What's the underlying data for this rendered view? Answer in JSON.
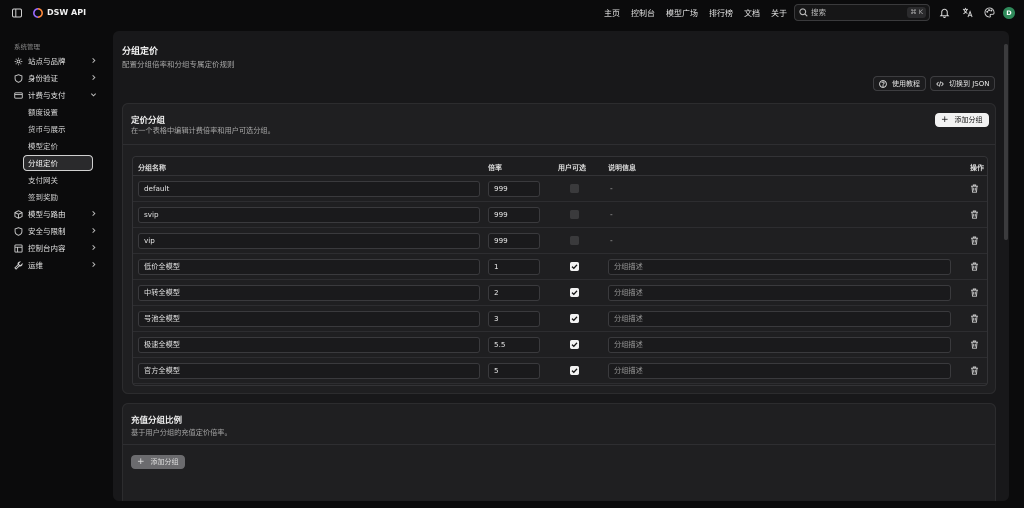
{
  "app": {
    "title": "DSW API",
    "avatar": "D"
  },
  "nav": [
    "主页",
    "控制台",
    "模型广场",
    "排行榜",
    "文档",
    "关于"
  ],
  "search": {
    "placeholder": "搜索",
    "shortcut": "⌘ K"
  },
  "sidebar": {
    "group_title": "系统管理",
    "items": [
      {
        "label": "站点与品牌",
        "icon": "gear-icon"
      },
      {
        "label": "身份验证",
        "icon": "shield-icon"
      },
      {
        "label": "计费与支付",
        "icon": "billing-icon",
        "expanded": true,
        "children": [
          "额度设置",
          "货币与展示",
          "模型定价",
          "分组定价",
          "支付网关",
          "签到奖励"
        ],
        "active_child": "分组定价"
      },
      {
        "label": "模型与路由",
        "icon": "cube-icon"
      },
      {
        "label": "安全与限制",
        "icon": "shield-icon"
      },
      {
        "label": "控制台内容",
        "icon": "layout-icon"
      },
      {
        "label": "运维",
        "icon": "wrench-icon"
      }
    ]
  },
  "page": {
    "title": "分组定价",
    "subtitle": "配置分组倍率和分组专属定价规则",
    "help_button": "使用教程",
    "json_button": "切换到 JSON"
  },
  "pricing_card": {
    "title": "定价分组",
    "subtitle": "在一个表格中编辑计费倍率和用户可选分组。",
    "add_button": "添加分组",
    "columns": [
      "分组名称",
      "倍率",
      "用户可选",
      "说明信息",
      "操作"
    ],
    "desc_placeholder": "分组描述",
    "rows": [
      {
        "name": "default",
        "ratio": "999",
        "selectable": false,
        "desc": "-"
      },
      {
        "name": "svip",
        "ratio": "999",
        "selectable": false,
        "desc": "-"
      },
      {
        "name": "vip",
        "ratio": "999",
        "selectable": false,
        "desc": "-"
      },
      {
        "name": "低价全模型",
        "ratio": "1",
        "selectable": true,
        "desc": ""
      },
      {
        "name": "中转全模型",
        "ratio": "2",
        "selectable": true,
        "desc": ""
      },
      {
        "name": "号池全模型",
        "ratio": "3",
        "selectable": true,
        "desc": ""
      },
      {
        "name": "极速全模型",
        "ratio": "5.5",
        "selectable": true,
        "desc": ""
      },
      {
        "name": "官方全模型",
        "ratio": "5",
        "selectable": true,
        "desc": ""
      }
    ]
  },
  "recharge_card": {
    "title": "充值分组比例",
    "subtitle": "基于用户分组的充值定价倍率。",
    "add_button": "添加分组"
  }
}
